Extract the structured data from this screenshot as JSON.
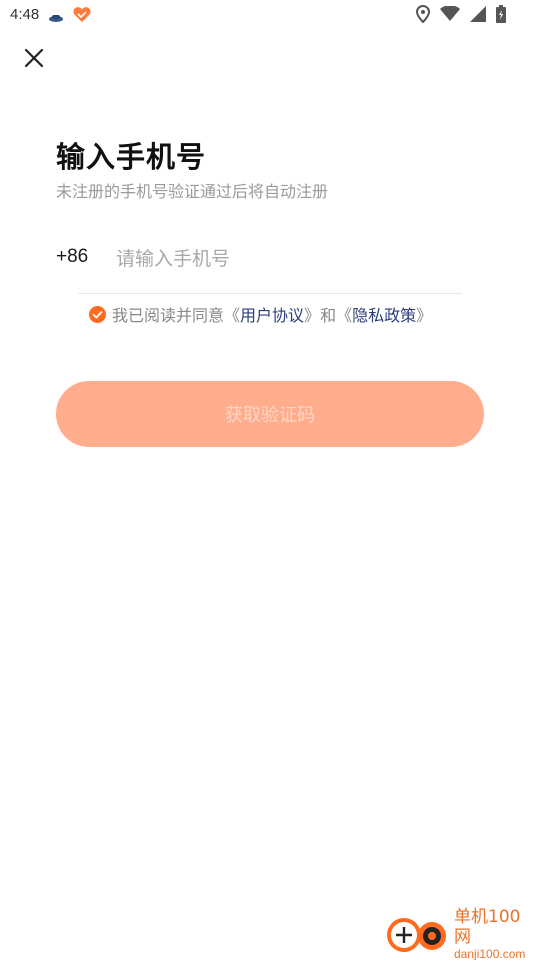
{
  "status_bar": {
    "time": "4:48",
    "icons": [
      "app-notification-icon",
      "heart-app-icon",
      "location-icon",
      "wifi-icon",
      "signal-icon",
      "battery-icon"
    ]
  },
  "header": {
    "close_icon": "close-icon"
  },
  "main": {
    "title": "输入手机号",
    "subtitle": "未注册的手机号验证通过后将自动注册",
    "country_code": "+86",
    "phone_placeholder": "请输入手机号",
    "phone_value": ""
  },
  "agreement": {
    "checked": true,
    "prefix": "我已阅读并同意",
    "open_bracket_1": "《",
    "user_agreement": "用户协议",
    "close_bracket_1": "》",
    "and": "和",
    "open_bracket_2": "《",
    "privacy_policy": "隐私政策",
    "close_bracket_2": "》"
  },
  "action": {
    "get_code_label": "获取验证码"
  },
  "watermark": {
    "name_cn": "单机100网",
    "domain": "danji100.com"
  },
  "colors": {
    "accent": "#ff6a1f",
    "button_bg": "#ffad8c",
    "button_text": "#ffd6c6",
    "link": "#2c3e7a",
    "muted": "#9a9a9a"
  }
}
